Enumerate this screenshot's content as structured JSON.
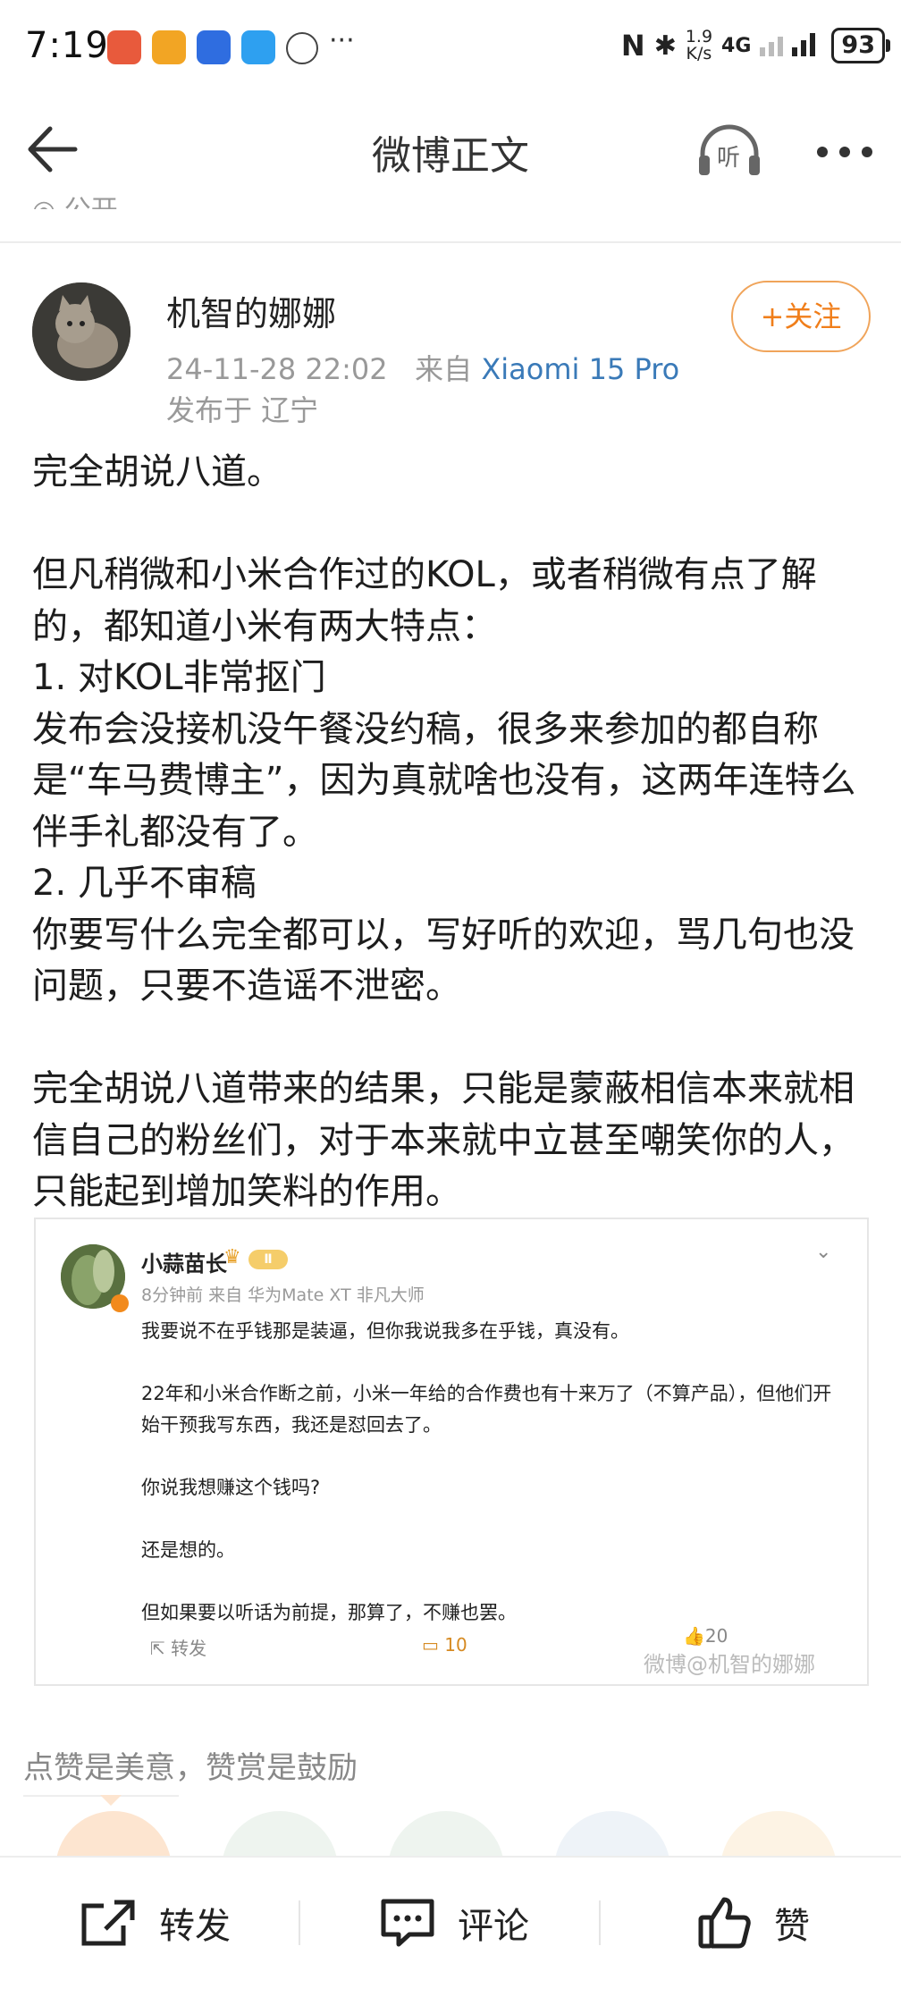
{
  "status_bar": {
    "time": "7:19",
    "more": "···",
    "speed_top": "1.9",
    "speed_bottom": "K/s",
    "network": "4G",
    "battery": "93"
  },
  "header": {
    "title": "微博正文",
    "listen_label": "听",
    "peek_text": "公开"
  },
  "author": {
    "name": "机智的娜娜",
    "time": "24-11-28 22:02",
    "from_label": "来自",
    "device": "Xiaomi 15 Pro",
    "location": "发布于 辽宁",
    "follow_label": "+关注"
  },
  "post": {
    "body": "完全胡说八道。\n\n但凡稍微和小米合作过的KOL，或者稍微有点了解的，都知道小米有两大特点：\n1. 对KOL非常抠门\n发布会没接机没午餐没约稿，很多来参加的都自称是“车马费博主”，因为真就啥也没有，这两年连特么伴手礼都没有了。\n2. 几乎不审稿\n你要写什么完全都可以，写好听的欢迎，骂几句也没问题，只要不造谣不泄密。\n\n完全胡说八道带来的结果，只能是蒙蔽相信本来就相信自己的粉丝们，对于本来就中立甚至嘲笑你的人，只能起到增加笑料的作用。"
  },
  "embedded": {
    "name": "小蒜苗长",
    "level": "Ⅱ",
    "meta": "8分钟前  来自 华为Mate XT 非凡大师",
    "text": "我要说不在乎钱那是装逼，但你我说我多在乎钱，真没有。\n\n22年和小米合作断之前，小米一年给的合作费也有十来万了（不算产品），但他们开始干预我写东西，我还是怼回去了。\n\n你说我想赚这个钱吗?\n\n还是想的。\n\n但如果要以听话为前提，那算了，不赚也罢。",
    "forward_label": "转发",
    "comment_count": "10",
    "like_count": "20",
    "watermark": "微博@机智的娜娜"
  },
  "reward": {
    "text": "点赞是美意，赞赏是鼓励"
  },
  "bottom_bar": {
    "forward": "转发",
    "comment": "评论",
    "like": "赞"
  },
  "colors": {
    "accent": "#f07e1a",
    "link": "#3a7ab8",
    "muted": "#999999"
  }
}
